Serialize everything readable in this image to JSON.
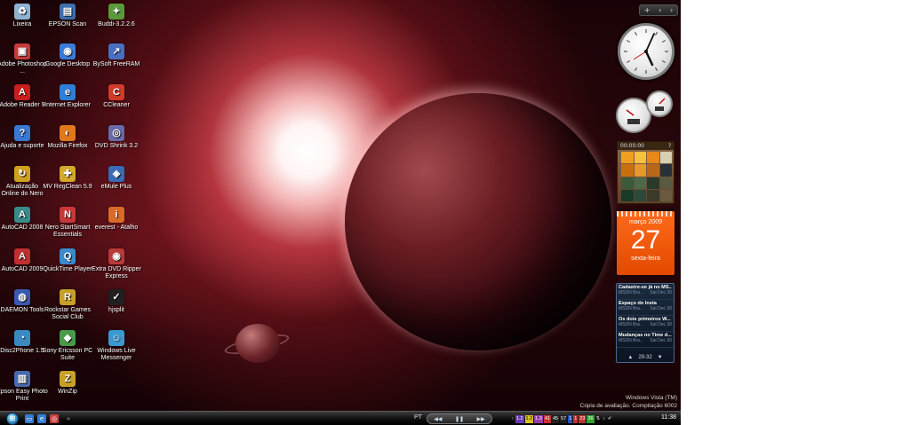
{
  "desktop_icons": [
    {
      "label": "Lixeira",
      "icon": "recycle-bin-icon",
      "color": "#8fb3d1",
      "glyph": "♻"
    },
    {
      "label": "EPSON Scan",
      "icon": "scanner-icon",
      "color": "#3c6fb0",
      "glyph": "▤"
    },
    {
      "label": "Buddi-3.2.2.6",
      "icon": "buddi-icon",
      "color": "#5a9a3a",
      "glyph": "✦"
    },
    {
      "label": "Adobe Photoshop ...",
      "icon": "photoshop-icon",
      "color": "#c43b3b",
      "glyph": "▣"
    },
    {
      "label": "Google Desktop",
      "icon": "google-desktop-icon",
      "color": "#3b7ad8",
      "glyph": "◉"
    },
    {
      "label": "BySoft FreeRAM",
      "icon": "freeram-icon",
      "color": "#4a6fc0",
      "glyph": "↗"
    },
    {
      "label": "Adobe Reader 9",
      "icon": "adobe-reader-icon",
      "color": "#c81e1e",
      "glyph": "A"
    },
    {
      "label": "Internet Explorer",
      "icon": "internet-explorer-icon",
      "color": "#2f7fd6",
      "glyph": "e"
    },
    {
      "label": "CCleaner",
      "icon": "ccleaner-icon",
      "color": "#d23a2a",
      "glyph": "C"
    },
    {
      "label": "Ajuda e suporte",
      "icon": "help-icon",
      "color": "#3a78d0",
      "glyph": "?"
    },
    {
      "label": "Mozilla Firefox",
      "icon": "firefox-icon",
      "color": "#e0781e",
      "glyph": "◐"
    },
    {
      "label": "DVD Shrink 3.2",
      "icon": "dvd-shrink-icon",
      "color": "#6a6aa8",
      "glyph": "◎"
    },
    {
      "label": "Atualização Online do Nero",
      "icon": "nero-update-icon",
      "color": "#d0a020",
      "glyph": "↻"
    },
    {
      "label": "MV RegClean 5.9",
      "icon": "regclean-icon",
      "color": "#d4a82a",
      "glyph": "✚"
    },
    {
      "label": "eMule Plus",
      "icon": "emule-icon",
      "color": "#3a6ab8",
      "glyph": "◈"
    },
    {
      "label": "AutoCAD 2008",
      "icon": "autocad-icon",
      "color": "#3a8a8a",
      "glyph": "A"
    },
    {
      "label": "Nero StartSmart Essentials",
      "icon": "nero-icon",
      "color": "#c83838",
      "glyph": "N"
    },
    {
      "label": "everest - Atalho",
      "icon": "everest-icon",
      "color": "#d86a2a",
      "glyph": "i"
    },
    {
      "label": "AutoCAD 2009",
      "icon": "autocad-icon",
      "color": "#c03030",
      "glyph": "A"
    },
    {
      "label": "QuickTime Player",
      "icon": "quicktime-icon",
      "color": "#3a8ad0",
      "glyph": "Q"
    },
    {
      "label": "Extra DVD Ripper Express",
      "icon": "dvd-ripper-icon",
      "color": "#b83a3a",
      "glyph": "◉"
    },
    {
      "label": "DAEMON Tools",
      "icon": "daemon-tools-icon",
      "color": "#3a5ab0",
      "glyph": "◍"
    },
    {
      "label": "Rockstar Games Social Club",
      "icon": "rockstar-icon",
      "color": "#c8a028",
      "glyph": "R"
    },
    {
      "label": "hjsplit",
      "icon": "hjsplit-icon",
      "color": "#202020",
      "glyph": "✓"
    },
    {
      "label": "Disc2Phone 1.5",
      "icon": "disc2phone-icon",
      "color": "#3a8ac0",
      "glyph": "◔"
    },
    {
      "label": "Sony Ericsson PC Suite",
      "icon": "sony-ericsson-icon",
      "color": "#4a9a4a",
      "glyph": "◆"
    },
    {
      "label": "Windows Live Messenger",
      "icon": "messenger-icon",
      "color": "#3a9ad0",
      "glyph": "☺"
    },
    {
      "label": "Epson Easy Photo Print",
      "icon": "photo-print-icon",
      "color": "#4a6ab0",
      "glyph": "▥"
    },
    {
      "label": "WinZip",
      "icon": "winzip-icon",
      "color": "#c8a028",
      "glyph": "Z"
    }
  ],
  "sidebar": {
    "controls": {
      "add": "+",
      "prev": "‹",
      "next": "›"
    },
    "calendar": {
      "month": "março 2009",
      "day": "27",
      "weekday": "sexta-feira"
    },
    "puzzle": {
      "timer": "00:00:00",
      "help": "?"
    },
    "feeds": {
      "items": [
        {
          "title": "Cadastre-se já no MS...",
          "source": "MSDN Bra...",
          "date": "Sat Dec 30"
        },
        {
          "title": "Espaço do Insta",
          "source": "MSDN Bra...",
          "date": "Sat Dec 30"
        },
        {
          "title": "Os dois primeiros W...",
          "source": "MSDN Bra...",
          "date": "Sat Dec 30"
        },
        {
          "title": "Mudanças no Time d...",
          "source": "MSDN Bra...",
          "date": "Sat Dec 30"
        }
      ],
      "nav_up": "▲",
      "page": "29-32",
      "nav_down": "▼"
    }
  },
  "watermark": {
    "line1": "Windows Vista (TM)",
    "line2": "Cópia de avaliação. Compilação 6002"
  },
  "taskbar": {
    "start": "⊞",
    "language": "PT",
    "media": {
      "prev": "◀◀",
      "play": "❚❚",
      "next": "▶▶"
    },
    "tray_values": [
      "1.2",
      "1.2",
      "1.3",
      "41",
      "45",
      "57",
      "1",
      "1",
      "23",
      "36"
    ],
    "clock": "11:38"
  },
  "colors": {
    "calendar": "#ff6a1a",
    "feeds_bg": "#1a2a3e",
    "taskbar": "#0e0e0e"
  }
}
